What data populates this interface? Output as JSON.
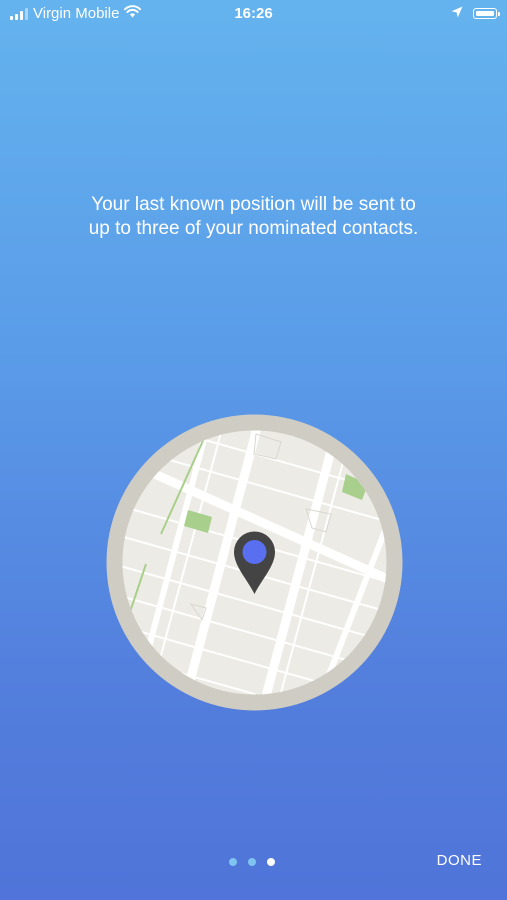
{
  "status_bar": {
    "carrier": "Virgin Mobile",
    "time": "16:26",
    "icons": [
      "signal-bars-icon",
      "wifi-icon",
      "location-arrow-icon",
      "battery-icon"
    ]
  },
  "onboarding": {
    "message_line1": "Your last known position will be sent to",
    "message_line2": "up to three of your nominated contacts.",
    "illustration": "map-pin-icon",
    "page_count": 3,
    "current_page": 3
  },
  "footer": {
    "done_label": "DONE"
  },
  "colors": {
    "background_top": "#64b3ee",
    "background_bottom": "#5074d9",
    "pin": "#444444",
    "pin_dot": "#5a6ff0",
    "map_base": "#ecebe5",
    "map_ring": "#cfccc4",
    "park": "#a9cf8c",
    "dot_inactive": "#7fc3f0",
    "dot_active": "#ffffff"
  }
}
